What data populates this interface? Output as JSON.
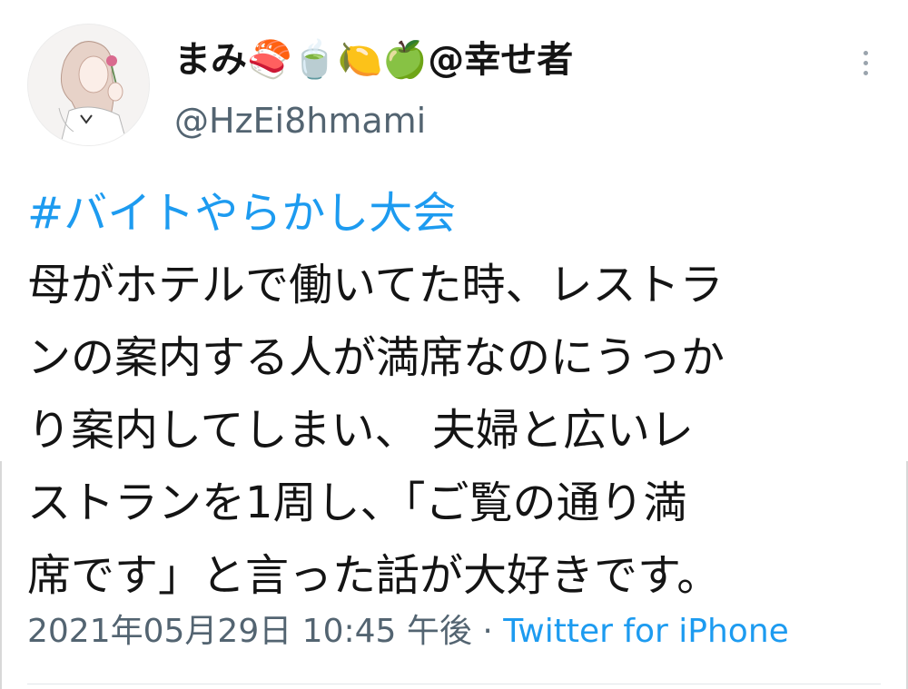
{
  "tweet": {
    "display_name": "まみ🍣🍵🍋🍏@幸せ者",
    "handle": "@HzEi8hmami",
    "hashtag": "#バイトやらかし大会",
    "body_lines": [
      "母がホテルで働いてた時、レストラ",
      "ンの案内する人が満席なのにうっか",
      "り案内してしまい、 夫婦と広いレ",
      "ストランを1周し、「ご覧の通り満",
      "席です」と言った話が大好きです。"
    ],
    "timestamp": "2021年05月29日 10:45 午後",
    "separator": "·",
    "source": "Twitter for iPhone"
  },
  "colors": {
    "link": "#1d9bf0",
    "secondary_text": "#536471",
    "primary_text": "#141414"
  },
  "icons": {
    "more": "more-vertical-icon",
    "avatar": "avatar-illustration"
  }
}
